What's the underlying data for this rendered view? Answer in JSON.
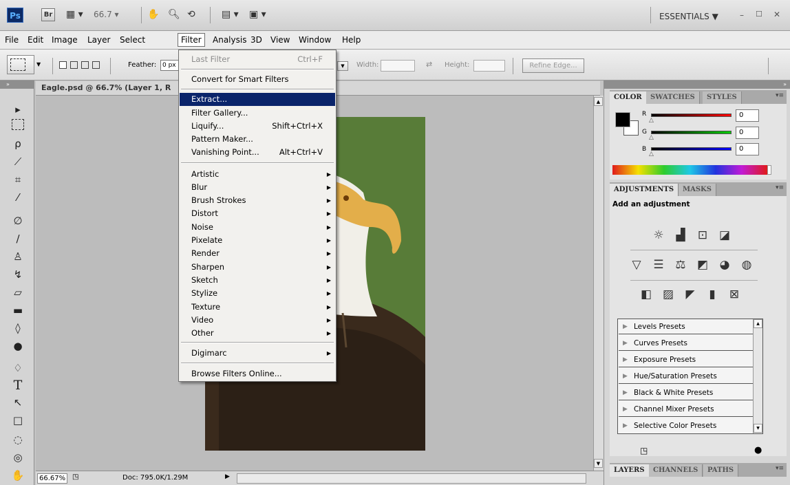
{
  "app": {
    "logo": "Ps",
    "bridge": "Br",
    "zoom_value": "66.7",
    "workspace": "ESSENTIALS",
    "workspace_arrow": "▼"
  },
  "menubar": [
    "File",
    "Edit",
    "Image",
    "Layer",
    "Select",
    "Filter",
    "Analysis",
    "3D",
    "View",
    "Window",
    "Help"
  ],
  "options": {
    "feather_label": "Feather:",
    "feather_value": "0 px",
    "width_label": "Width:",
    "height_label": "Height:",
    "refine_edge": "Refine Edge..."
  },
  "document": {
    "tab_title": "Eagle.psd @ 66.7% (Layer 1, R",
    "status_zoom": "66.67%",
    "status_doc": "Doc: 795.0K/1.29M"
  },
  "filter_menu": {
    "last_filter": "Last Filter",
    "last_filter_shortcut": "Ctrl+F",
    "convert": "Convert for Smart Filters",
    "extract": "Extract...",
    "gallery": "Filter Gallery...",
    "liquify": "Liquify...",
    "liquify_shortcut": "Shift+Ctrl+X",
    "pattern": "Pattern Maker...",
    "vanishing": "Vanishing Point...",
    "vanishing_shortcut": "Alt+Ctrl+V",
    "submenus": [
      "Artistic",
      "Blur",
      "Brush Strokes",
      "Distort",
      "Noise",
      "Pixelate",
      "Render",
      "Sharpen",
      "Sketch",
      "Stylize",
      "Texture",
      "Video",
      "Other"
    ],
    "digimarc": "Digimarc",
    "browse": "Browse Filters Online..."
  },
  "color_panel": {
    "tabs": [
      "COLOR",
      "SWATCHES",
      "STYLES"
    ],
    "r_label": "R",
    "g_label": "G",
    "b_label": "B",
    "r_value": "0",
    "g_value": "0",
    "b_value": "0"
  },
  "adjust_panel": {
    "tabs": [
      "ADJUSTMENTS",
      "MASKS"
    ],
    "heading": "Add an adjustment",
    "presets": [
      "Levels Presets",
      "Curves Presets",
      "Exposure Presets",
      "Hue/Saturation Presets",
      "Black & White Presets",
      "Channel Mixer Presets",
      "Selective Color Presets"
    ]
  },
  "layers_panel": {
    "tabs": [
      "LAYERS",
      "CHANNELS",
      "PATHS"
    ]
  }
}
